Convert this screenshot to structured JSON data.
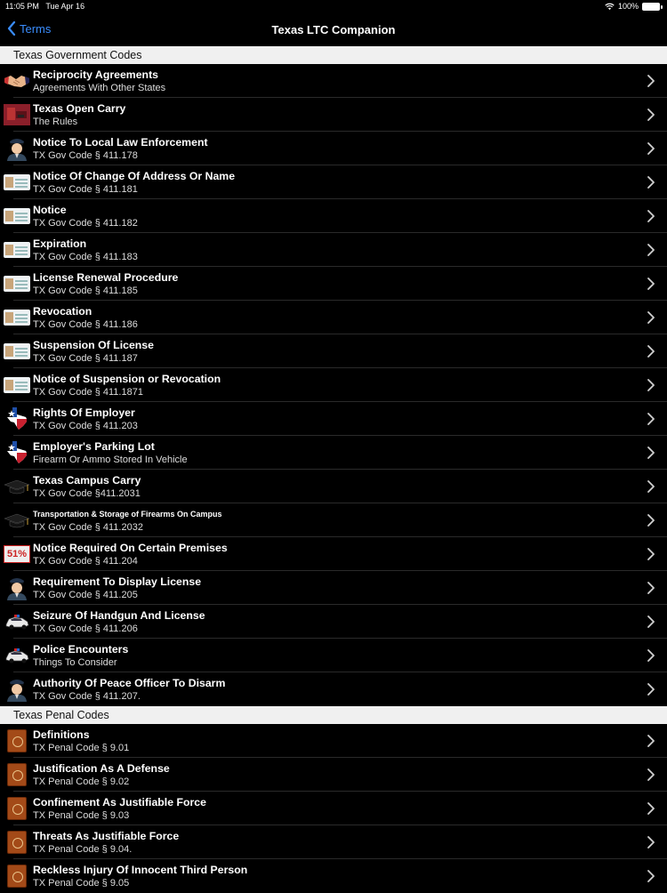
{
  "status": {
    "time": "11:05 PM",
    "date": "Tue Apr 16",
    "battery": "100%"
  },
  "nav": {
    "back_label": "Terms",
    "title": "Texas LTC Companion"
  },
  "sections": [
    {
      "header": "Texas Government Codes",
      "rows": [
        {
          "icon": "handshake-icon",
          "title": "Reciprocity Agreements",
          "sub": "Agreements With Other States"
        },
        {
          "icon": "open-carry-photo-icon",
          "title": "Texas Open Carry",
          "sub": "The Rules"
        },
        {
          "icon": "officer-icon",
          "title": "Notice To Local Law Enforcement",
          "sub": "TX Gov Code § 411.178"
        },
        {
          "icon": "license-card-icon",
          "title": "Notice Of Change Of Address Or Name",
          "sub": "TX Gov Code § 411.181"
        },
        {
          "icon": "license-card-icon",
          "title": "Notice",
          "sub": "TX Gov Code § 411.182"
        },
        {
          "icon": "license-card-icon",
          "title": "Expiration",
          "sub": "TX Gov Code § 411.183"
        },
        {
          "icon": "license-card-icon",
          "title": "License Renewal Procedure",
          "sub": "TX Gov Code § 411.185"
        },
        {
          "icon": "license-card-icon",
          "title": "Revocation",
          "sub": "TX Gov Code § 411.186"
        },
        {
          "icon": "license-card-icon",
          "title": "Suspension Of License",
          "sub": "TX Gov Code § 411.187"
        },
        {
          "icon": "license-card-icon",
          "title": "Notice of Suspension or Revocation",
          "sub": "TX Gov Code § 411.1871"
        },
        {
          "icon": "texas-map-icon",
          "title": "Rights Of Employer",
          "sub": "TX Gov Code § 411.203"
        },
        {
          "icon": "texas-map-icon",
          "title": "Employer's Parking Lot",
          "sub": "Firearm Or Ammo Stored In Vehicle"
        },
        {
          "icon": "graduation-cap-icon",
          "title": "Texas Campus Carry",
          "sub": "TX Gov Code §411.2031"
        },
        {
          "icon": "graduation-cap-icon",
          "title": "Transportation & Storage of Firearms On Campus",
          "sub": "TX Gov Code § 411.2032",
          "small": true
        },
        {
          "icon": "sign-51-icon",
          "title": "Notice Required On Certain Premises",
          "sub": "TX Gov Code § 411.204",
          "badge": "51%"
        },
        {
          "icon": "officer-icon",
          "title": "Requirement To Display License",
          "sub": "TX Gov Code § 411.205"
        },
        {
          "icon": "police-car-icon",
          "title": "Seizure Of Handgun And License",
          "sub": "TX Gov Code § 411.206"
        },
        {
          "icon": "police-car-icon",
          "title": "Police Encounters",
          "sub": "Things To Consider"
        },
        {
          "icon": "officer-icon",
          "title": "Authority Of Peace Officer To Disarm",
          "sub": "TX Gov Code § 411.207."
        }
      ]
    },
    {
      "header": "Texas Penal Codes",
      "rows": [
        {
          "icon": "law-book-icon",
          "title": "Definitions",
          "sub": "TX Penal Code § 9.01"
        },
        {
          "icon": "law-book-icon",
          "title": "Justification As A Defense",
          "sub": "TX Penal Code § 9.02"
        },
        {
          "icon": "law-book-icon",
          "title": "Confinement As Justifiable Force",
          "sub": "TX Penal Code § 9.03"
        },
        {
          "icon": "law-book-icon",
          "title": "Threats As Justifiable Force",
          "sub": "TX Penal Code § 9.04."
        },
        {
          "icon": "law-book-icon",
          "title": "Reckless Injury Of Innocent Third Person",
          "sub": "TX Penal Code § 9.05"
        }
      ]
    }
  ]
}
